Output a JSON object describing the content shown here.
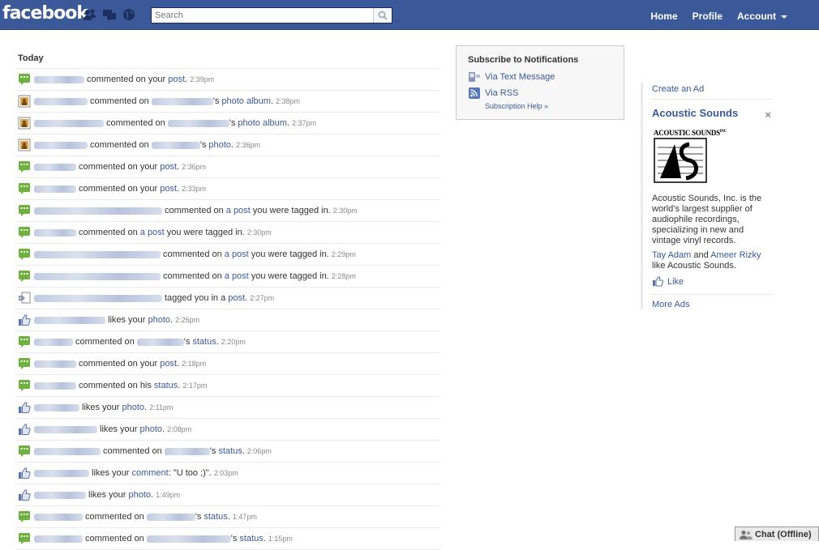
{
  "brand": {
    "logo": "facebook"
  },
  "header": {
    "search": {
      "placeholder": "Search",
      "value": ""
    },
    "nav": {
      "home": "Home",
      "profile": "Profile",
      "account": "Account"
    }
  },
  "notifications": {
    "section_title": "Today",
    "rows": [
      {
        "icon": "comment-icon",
        "p1": "commented on your",
        "link1": "post",
        "p2": ".",
        "link2": "",
        "p3": "",
        "time": "2:39pm"
      },
      {
        "icon": "photo-icon",
        "p1": "commented on",
        "link1": "",
        "p2": "'s",
        "link2": "photo album",
        "p3": ".",
        "time": "2:38pm"
      },
      {
        "icon": "photo-icon",
        "p1": "commented on",
        "link1": "",
        "p2": "'s",
        "link2": "photo album",
        "p3": ".",
        "time": "2:37pm"
      },
      {
        "icon": "photo-icon",
        "p1": "commented on",
        "link1": "",
        "p2": "'s",
        "link2": "photo",
        "p3": ".",
        "time": "2:36pm"
      },
      {
        "icon": "comment-icon",
        "p1": "commented on your",
        "link1": "post",
        "p2": ".",
        "link2": "",
        "p3": "",
        "time": "2:36pm"
      },
      {
        "icon": "comment-icon",
        "p1": "commented on your",
        "link1": "post",
        "p2": ".",
        "link2": "",
        "p3": "",
        "time": "2:33pm"
      },
      {
        "icon": "comment-icon",
        "p1": "commented on",
        "link1": "a post",
        "p2": "you were tagged in.",
        "link2": "",
        "p3": "",
        "time": "2:30pm"
      },
      {
        "icon": "comment-icon",
        "p1": "commented on",
        "link1": "a post",
        "p2": "you were tagged in.",
        "link2": "",
        "p3": "",
        "time": "2:30pm"
      },
      {
        "icon": "comment-icon",
        "p1": "commented on",
        "link1": "a post",
        "p2": "you were tagged in.",
        "link2": "",
        "p3": "",
        "time": "2:29pm"
      },
      {
        "icon": "comment-icon",
        "p1": "commented on",
        "link1": "a post",
        "p2": "you were tagged in.",
        "link2": "",
        "p3": "",
        "time": "2:28pm"
      },
      {
        "icon": "tag-icon",
        "p1": "tagged you in a",
        "link1": "post",
        "p2": ".",
        "link2": "",
        "p3": "",
        "time": "2:27pm"
      },
      {
        "icon": "like-icon",
        "p1": "likes your",
        "link1": "photo",
        "p2": ".",
        "link2": "",
        "p3": "",
        "time": "2:26pm"
      },
      {
        "icon": "comment-icon",
        "p1": "commented on",
        "link1": "",
        "p2": "'s",
        "link2": "status",
        "p3": ".",
        "time": "2:20pm"
      },
      {
        "icon": "comment-icon",
        "p1": "commented on your",
        "link1": "post",
        "p2": ".",
        "link2": "",
        "p3": "",
        "time": "2:18pm"
      },
      {
        "icon": "comment-icon",
        "p1": "commented on his",
        "link1": "status",
        "p2": ".",
        "link2": "",
        "p3": "",
        "time": "2:17pm"
      },
      {
        "icon": "like-icon",
        "p1": "likes your",
        "link1": "photo",
        "p2": ".",
        "link2": "",
        "p3": "",
        "time": "2:11pm"
      },
      {
        "icon": "like-icon",
        "p1": "likes your",
        "link1": "photo",
        "p2": ".",
        "link2": "",
        "p3": "",
        "time": "2:08pm"
      },
      {
        "icon": "comment-icon",
        "p1": "commented on",
        "link1": "",
        "p2": "'s",
        "link2": "status",
        "p3": ".",
        "time": "2:06pm"
      },
      {
        "icon": "like-icon",
        "p1": "likes your",
        "link1": "comment",
        "p2": ": \"U too ;)\".",
        "link2": "",
        "p3": "",
        "time": "2:03pm"
      },
      {
        "icon": "like-icon",
        "p1": "likes your",
        "link1": "photo",
        "p2": ".",
        "link2": "",
        "p3": "",
        "time": "1:49pm"
      },
      {
        "icon": "comment-icon",
        "p1": "commented on",
        "link1": "",
        "p2": "'s",
        "link2": "status",
        "p3": ".",
        "time": "1:47pm"
      },
      {
        "icon": "comment-icon",
        "p1": "commented on",
        "link1": "",
        "p2": "'s",
        "link2": "status",
        "p3": ".",
        "time": "1:15pm"
      }
    ]
  },
  "subscribe": {
    "title": "Subscribe to Notifications",
    "via_text": "Via Text Message",
    "via_rss": "Via RSS",
    "help": "Subscription Help »"
  },
  "ads": {
    "create": "Create an Ad",
    "title": "Acoustic Sounds",
    "close": "×",
    "logo_text": "ACOUSTIC SOUNDS",
    "logo_suffix": "INC",
    "description": "Acoustic Sounds, Inc. is the world's largest supplier of audiophile recordings, specializing in new and vintage vinyl records.",
    "friend1": "Tay Adam",
    "and": "and",
    "friend2": "Ameer Rizky",
    "likes_suffix": "like Acoustic Sounds.",
    "like": "Like",
    "more": "More Ads"
  },
  "chat": {
    "label": "Chat (Offline)"
  },
  "colors": {
    "brand_blue": "#3b5998",
    "link": "#3b5998",
    "comment_green": "#6fb13f"
  }
}
